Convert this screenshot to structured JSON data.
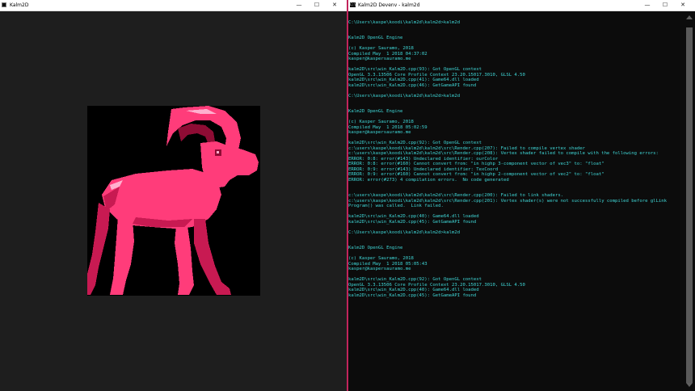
{
  "left_window": {
    "title": "Kalm2D",
    "controls": {
      "minimize": "—",
      "maximize": "☐",
      "close": "✕"
    },
    "sprite": {
      "name": "pink-ram-sprite",
      "body_color": "#ff3c7a",
      "shade_color": "#c81a52",
      "dark_color": "#8e0c34",
      "highlight_color": "#ffb0cf",
      "background": "#000000"
    }
  },
  "right_window": {
    "title": "Kalm2D Devenv - kalm2d",
    "icon_label": "C:\\",
    "controls": {
      "minimize": "—",
      "maximize": "☐",
      "close": "✕"
    },
    "text_color": "#3fd6d6",
    "console_lines": [
      "",
      "C:\\Users\\kaspe\\koodi\\kalm2d\\kalm2d>kalm2d",
      "",
      "",
      "Kalm2D OpenGL Engine",
      "",
      "(c) Kasper Sauramo, 2018",
      "Compiled May  1 2018 04:37:02",
      "kasper@kaspersauramo.me",
      "",
      "kalm2D\\src\\win_Kalm2D.cpp(93): Got OpenGL context",
      "OpenGL 3.3.13506 Core Profile Context 23.20.15017.3010, GLSL 4.50",
      "kalm2D\\src\\win_Kalm2D.cpp(41): Game64.dll loaded",
      "kalm2D\\src\\win_Kalm2D.cpp(46): GetGameAPI found",
      "",
      "C:\\Users\\kaspe\\koodi\\kalm2d\\kalm2d>kalm2d",
      "",
      "",
      "Kalm2D OpenGL Engine",
      "",
      "(c) Kasper Sauramo, 2018",
      "Compiled May  1 2018 05:02:59",
      "kasper@kaspersauramo.me",
      "",
      "kalm2D\\src\\win_Kalm2D.cpp(92): Got OpenGL context",
      "c:\\users\\kaspe\\koodi\\kalm2d\\kalm2d\\src\\Render.cpp(207): Failed to compile vertex shader",
      "c:\\users\\kaspe\\koodi\\kalm2d\\kalm2d\\src\\Render.cpp(208): Vertex shader failed to compile with the following errors:",
      "ERROR: 0:8: error(#143) Undeclared identifier: ourColor",
      "ERROR: 0:8: error(#160) Cannot convert from: \"in highp 3-component vector of vec3\" to: \"float\"",
      "ERROR: 0:9: error(#143) Undeclared identifier: TexCoord",
      "ERROR: 0:9: error(#160) Cannot convert from: \"in highp 2-component vector of vec2\" to: \"float\"",
      "ERROR: error(#273) 4 compilation errors.  No code generated",
      "",
      "",
      "c:\\users\\kaspe\\koodi\\kalm2d\\kalm2d\\src\\Render.cpp(200): Failed to link shaders.",
      "c:\\users\\kaspe\\koodi\\kalm2d\\kalm2d\\src\\Render.cpp(201): Vertex shader(s) were not successfully compiled before glLink",
      "Program() was called.  Link failed.",
      "",
      "kalm2D\\src\\win_Kalm2D.cpp(40): Game64.dll loaded",
      "kalm2D\\src\\win_Kalm2D.cpp(45): GetGameAPI found",
      "",
      "C:\\Users\\kaspe\\koodi\\kalm2d\\kalm2d>kalm2d",
      "",
      "",
      "Kalm2D OpenGL Engine",
      "",
      "(c) Kasper Sauramo, 2018",
      "Compiled May  1 2018 05:05:43",
      "kasper@kaspersauramo.me",
      "",
      "kalm2D\\src\\win_Kalm2D.cpp(92): Got OpenGL context",
      "OpenGL 3.3.13506 Core Profile Context 23.20.15017.3010, GLSL 4.50",
      "kalm2D\\src\\win_Kalm2D.cpp(40): Game64.dll loaded",
      "kalm2D\\src\\win_Kalm2D.cpp(45): GetGameAPI found"
    ]
  }
}
